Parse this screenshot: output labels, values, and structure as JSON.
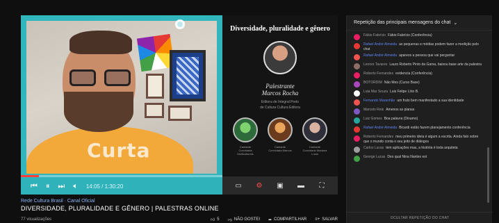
{
  "slide": {
    "title": "Diversidade, pluralidade e gênero",
    "role": "Palestrante",
    "name": "Marcos Rocha",
    "desc_line1": "Editora de Integral Preto",
    "desc_line2": "de Cultura Cultura Editora",
    "guests": [
      {
        "line1": "Cantante",
        "line2": "Convidada Multiculturais"
      },
      {
        "line1": "Cantante",
        "line2": "Convidada Marcos"
      },
      {
        "line1": "Cantante",
        "line2": "Convidado Mariana Lucia"
      }
    ]
  },
  "camera": {
    "shirt_text": "Curta"
  },
  "player": {
    "time": "14:05 / 1:30:20",
    "progress": 0.09
  },
  "video": {
    "channel": "Rede Cultura Brasil · Canal Oficial",
    "title": "DIVERSIDADE, PLURALIDADE E GÊNERO | PALESTRAS ONLINE",
    "views": "77 visualizações",
    "likes": "5",
    "dislike": "NÃO GOSTEI",
    "share": "COMPARTILHAR",
    "save": "SALVAR"
  },
  "chat": {
    "header": "Repetição das principais mensagens do chat",
    "footer": "OCULTAR REPETIÇÃO DO CHAT",
    "messages": [
      {
        "name": "Fábio Fabrício",
        "text": "Fábio Fabrício (Conferência)",
        "color": "#e91e63",
        "mod": false
      },
      {
        "name": "Rafael André Almeida",
        "text": "as pequenas e médias podem fazer a medição pelo chat",
        "color": "#e53935",
        "mod": true
      },
      {
        "name": "Rafael André Almeida",
        "text": "aparece a pessoa que vai perguntar",
        "color": "#ef5350",
        "mod": true
      },
      {
        "name": "Leonor Tavares",
        "text": "Lauro Roberto Pinto da Gama, baixou base arte da palestra",
        "color": "#8d6e63",
        "mod": false
      },
      {
        "name": "Roberto Fernandes",
        "text": "evidencia (Conferência)",
        "color": "#e91e63",
        "mod": false
      },
      {
        "name": "BOTORDIM",
        "text": "Não Mes (Curso Base)",
        "color": "#ab47bc",
        "mod": false
      },
      {
        "name": "Lula Mar Souza",
        "text": "Luis Felipe Lírio B.",
        "color": "#fafafa",
        "mod": false
      },
      {
        "name": "Fernando Maranhão",
        "text": "um fruto bem manifestado a sua identidade",
        "color": "#ef5350",
        "mod": true
      },
      {
        "name": "Marcelo Reis",
        "text": "Amenos as planas",
        "color": "#7e57c2",
        "mod": false
      },
      {
        "name": "Luiz Gomes",
        "text": "Boa palavra (Dinamo)",
        "color": "#26a69a",
        "mod": false
      },
      {
        "name": "Rafael André Almeida",
        "text": "Bicardi estão fazem planejamento conferência",
        "color": "#e53935",
        "mod": true
      },
      {
        "name": "Roberto Fernandes",
        "text": "meu primeiro ideia é algum a escrita. Ainda falo sobre que o mundo conta o seu jeito de diálogos",
        "color": "#e91e63",
        "mod": false
      },
      {
        "name": "Carlos Lucas",
        "text": "tem aplicações mas, a história é toda arquiteta",
        "color": "#9e9e9e",
        "mod": false
      },
      {
        "name": "George Lucas",
        "text": "Des qual Nina Nantes est",
        "color": "#43a047",
        "mod": false
      }
    ]
  }
}
